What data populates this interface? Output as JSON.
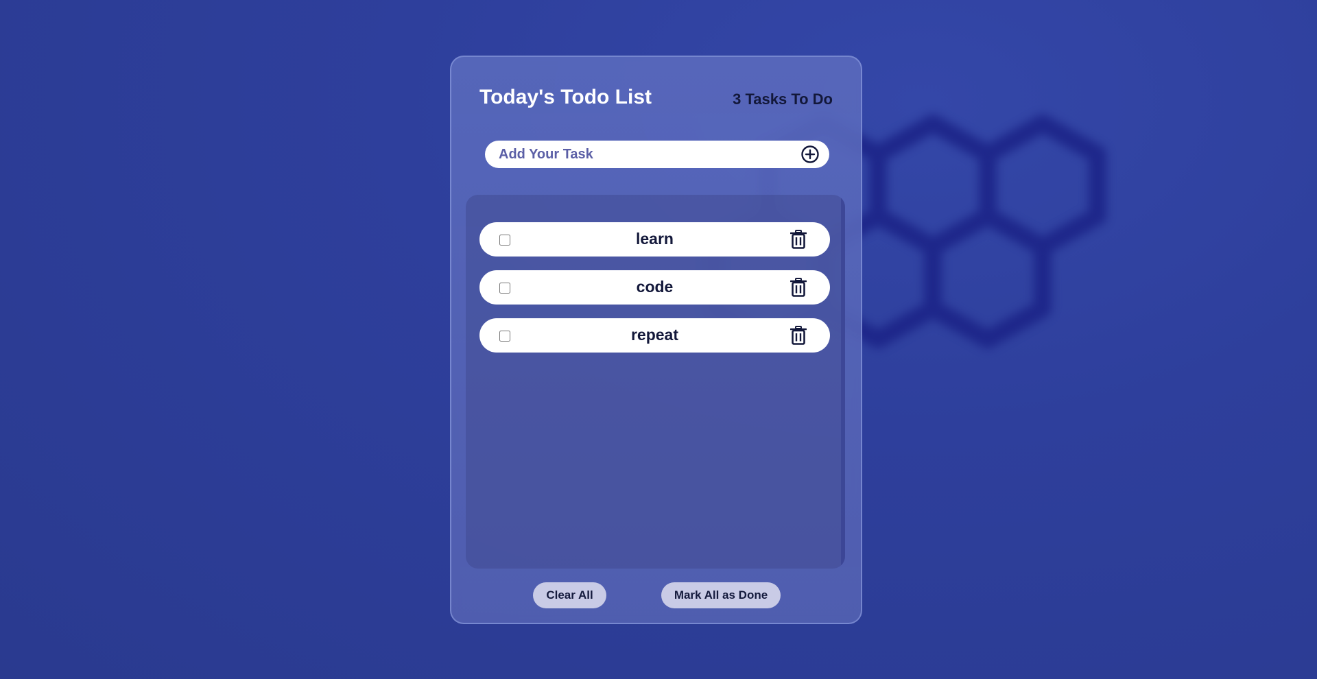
{
  "header": {
    "title": "Today's Todo List",
    "count_label": "3 Tasks To Do"
  },
  "add_task": {
    "placeholder": "Add Your Task",
    "icon": "plus-circle-icon"
  },
  "tasks": [
    {
      "text": "learn",
      "done": false
    },
    {
      "text": "code",
      "done": false
    },
    {
      "text": "repeat",
      "done": false
    }
  ],
  "footer": {
    "clear_label": "Clear All",
    "mark_done_label": "Mark All as Done"
  },
  "colors": {
    "background": "#2e3f9c",
    "card": "#5c6cbe",
    "text_dark": "#13183a",
    "accent_placeholder": "#5b5fa6",
    "button_bg": "#c9cbe6"
  }
}
